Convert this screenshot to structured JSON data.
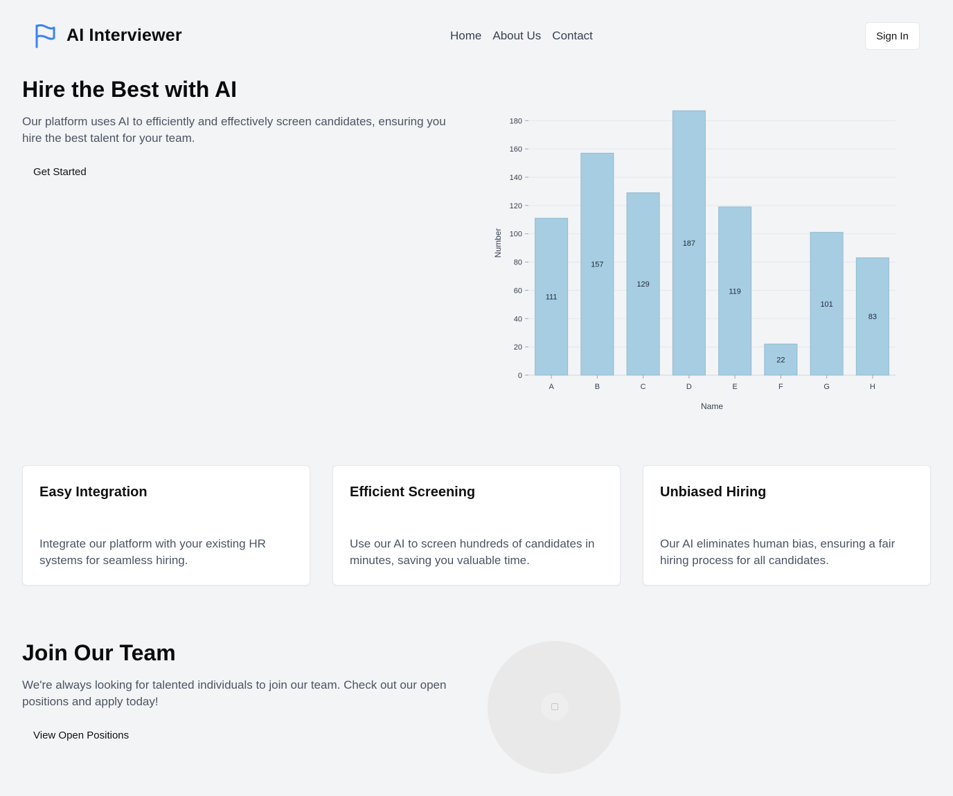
{
  "header": {
    "brand": "AI Interviewer",
    "nav": [
      "Home",
      "About Us",
      "Contact"
    ],
    "signin_label": "Sign In",
    "logo_icon": "flag-icon",
    "logo_color": "#3b82f6"
  },
  "hero": {
    "title": "Hire the Best with AI",
    "text": "Our platform uses AI to efficiently and effectively screen candidates, ensuring you hire the best talent for your team.",
    "cta_label": "Get Started"
  },
  "chart_data": {
    "type": "bar",
    "categories": [
      "A",
      "B",
      "C",
      "D",
      "E",
      "F",
      "G",
      "H"
    ],
    "values": [
      111,
      157,
      129,
      187,
      119,
      22,
      101,
      83
    ],
    "xlabel": "Name",
    "ylabel": "Number",
    "ylim": [
      0,
      187
    ],
    "yticks": [
      0,
      20,
      40,
      60,
      80,
      100,
      120,
      140,
      160,
      180
    ],
    "grid": true,
    "bar_color": "#a6cde2",
    "data_labels": true
  },
  "features": [
    {
      "title": "Easy Integration",
      "text": "Integrate our platform with your existing HR systems for seamless hiring."
    },
    {
      "title": "Efficient Screening",
      "text": "Use our AI to screen hundreds of candidates in minutes, saving you valuable time."
    },
    {
      "title": "Unbiased Hiring",
      "text": "Our AI eliminates human bias, ensuring a fair hiring process for all candidates."
    }
  ],
  "join": {
    "title": "Join Our Team",
    "text": "We're always looking for talented individuals to join our team. Check out our open positions and apply today!",
    "cta_label": "View Open Positions",
    "image_icon": "image-placeholder-icon"
  }
}
